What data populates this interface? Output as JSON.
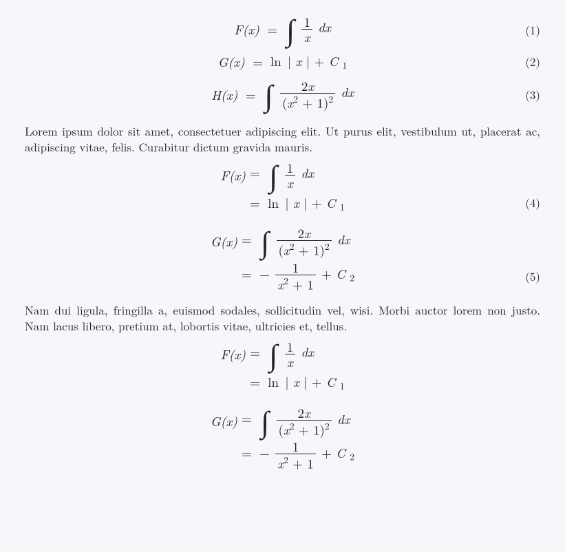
{
  "block1": {
    "r1": {
      "lhs": "F(x)",
      "eq": "=",
      "int": "∫",
      "frac_num": "1",
      "frac_den": "x",
      "dx": " dx",
      "tag": "(1)"
    },
    "r2": {
      "lhs": "G(x)",
      "eq": "=",
      "rhs_a": "ln",
      "abs_l": "|",
      "xvar": "x",
      "abs_r": "|",
      "plus": " + ",
      "C": "C",
      "Csub": "1",
      "tag": "(2)"
    },
    "r3": {
      "lhs": "H(x)",
      "eq": "=",
      "int": "∫",
      "num_a": "2",
      "num_b": "x",
      "den_l": "(",
      "den_x": "x",
      "den_p2a": "2",
      "den_mid": " + 1)",
      "den_p2b": "2",
      "dx": " dx",
      "tag": "(3)"
    }
  },
  "para1": "Lorem ipsum dolor sit amet, consectetuer adipiscing elit. Ut purus elit, vesti­bulum ut, placerat ac, adipiscing vitae, felis. Curabitur dictum gravida mauris.",
  "block2": {
    "r1": {
      "lhs": "F(x)",
      "eq": "=",
      "int": "∫",
      "frac_num": "1",
      "frac_den": "x",
      "dx": " dx"
    },
    "r2": {
      "eq": "=",
      "rhs_a": "ln",
      "abs_l": "|",
      "xvar": "x",
      "abs_r": "|",
      "plus": " + ",
      "C": "C",
      "Csub": "1",
      "tag": "(4)"
    },
    "r3": {
      "lhs": "G(x)",
      "eq": "=",
      "int": "∫",
      "num_a": "2",
      "num_b": "x",
      "den_l": "(",
      "den_x": "x",
      "den_p2a": "2",
      "den_mid": " + 1)",
      "den_p2b": "2",
      "dx": " dx"
    },
    "r4": {
      "eq": "=",
      "neg": "−",
      "frac_num": "1",
      "den_x": "x",
      "den_p2": "2",
      "den_tail": " + 1",
      "plus": " + ",
      "C": "C",
      "Csub": "2",
      "tag": "(5)"
    }
  },
  "para2": "Nam dui ligula, fringilla a, euismod sodales, sollicitudin vel, wisi. Morbi auctor lorem non justo. Nam lacus libero, pretium at, lobortis vitae, ultricies et, tellus.",
  "block3": {
    "r1": {
      "lhs": "F(x)",
      "eq": "=",
      "int": "∫",
      "frac_num": "1",
      "frac_den": "x",
      "dx": " dx"
    },
    "r2": {
      "eq": "=",
      "rhs_a": "ln",
      "abs_l": "|",
      "xvar": "x",
      "abs_r": "|",
      "plus": " + ",
      "C": "C",
      "Csub": "1"
    },
    "r3": {
      "lhs": "G(x)",
      "eq": "=",
      "int": "∫",
      "num_a": "2",
      "num_b": "x",
      "den_l": "(",
      "den_x": "x",
      "den_p2a": "2",
      "den_mid": " + 1)",
      "den_p2b": "2",
      "dx": " dx"
    },
    "r4": {
      "eq": "=",
      "neg": "−",
      "frac_num": "1",
      "den_x": "x",
      "den_p2": "2",
      "den_tail": " + 1",
      "plus": " + ",
      "C": "C",
      "Csub": "2"
    }
  }
}
